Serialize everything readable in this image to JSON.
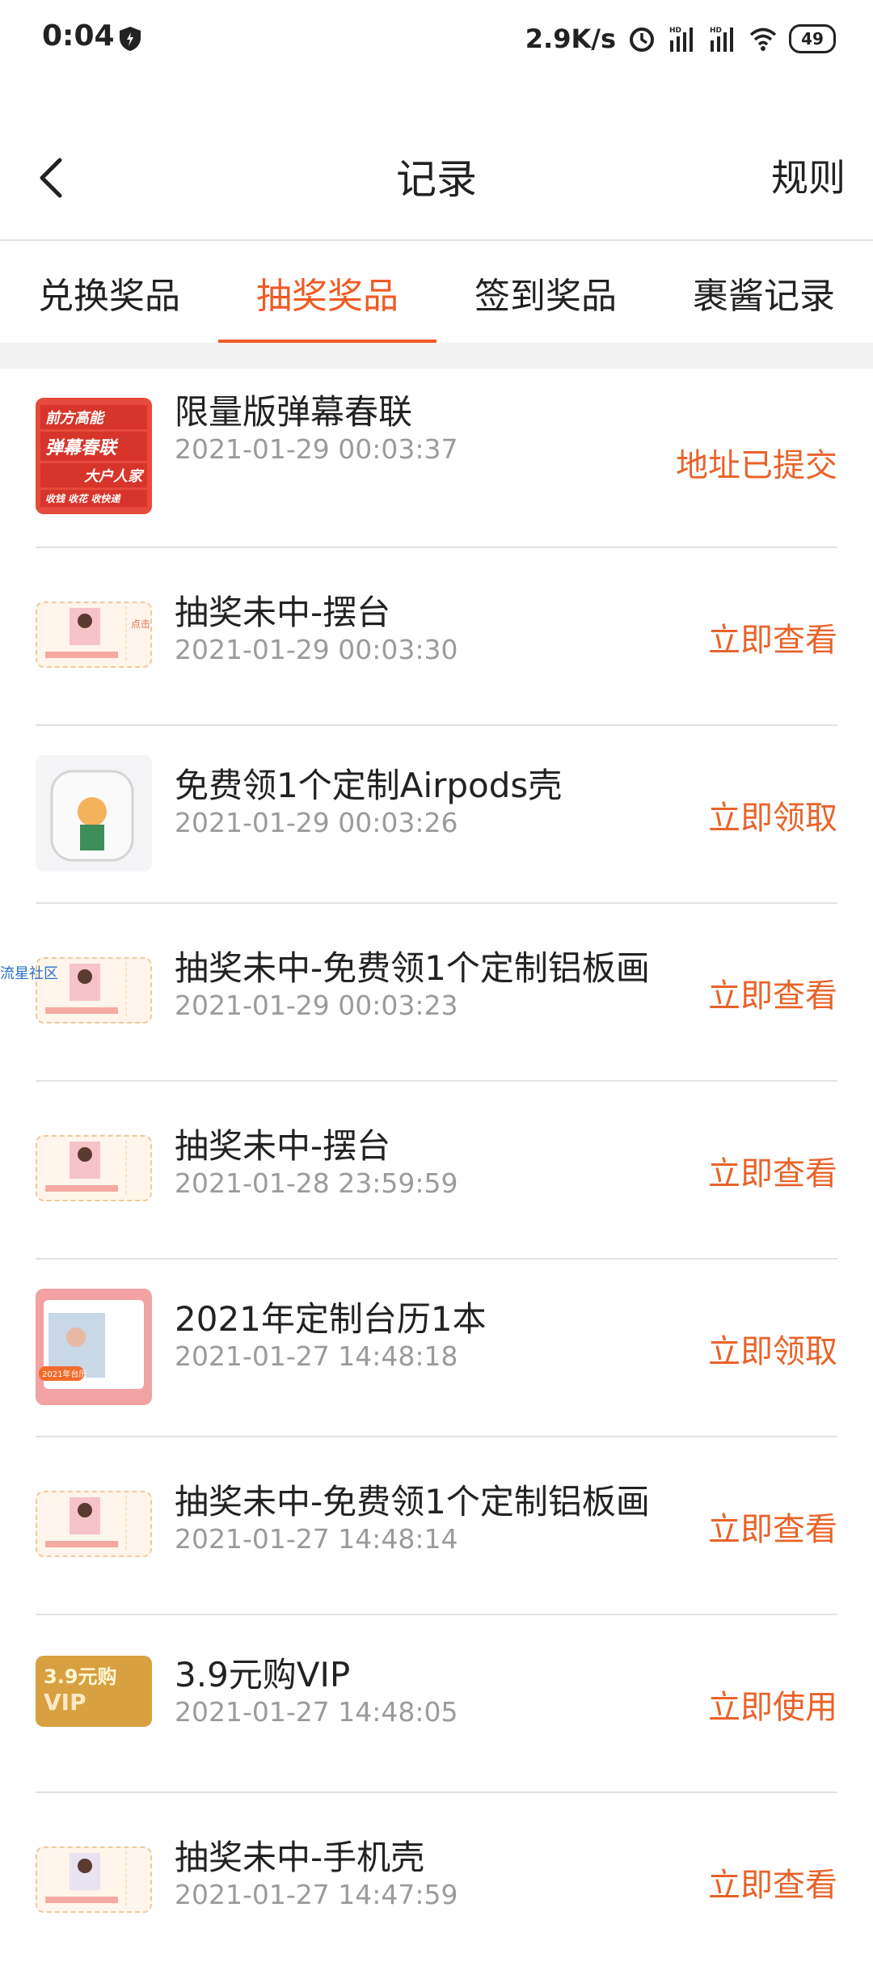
{
  "status": {
    "time": "0:04",
    "speed": "2.9K/s",
    "battery": "49"
  },
  "header": {
    "title": "记录",
    "rules": "规则"
  },
  "tabs": [
    {
      "label": "兑换奖品",
      "active": false
    },
    {
      "label": "抽奖奖品",
      "active": true
    },
    {
      "label": "签到奖品",
      "active": false
    },
    {
      "label": "裹酱记录",
      "active": false
    }
  ],
  "colors": {
    "accent": "#f05a24",
    "action": "#e8632a",
    "date": "#9b9b9b"
  },
  "watermark": "流星社区",
  "rows": [
    {
      "title": "限量版弹幕春联",
      "date": "2021-01-29 00:03:37",
      "action": "地址已提交",
      "thumb": "couplet"
    },
    {
      "title": "抽奖未中-摆台",
      "date": "2021-01-29 00:03:30",
      "action": "立即查看",
      "thumb": "ticket"
    },
    {
      "title": "免费领1个定制Airpods壳",
      "date": "2021-01-29 00:03:26",
      "action": "立即领取",
      "thumb": "case"
    },
    {
      "title": "抽奖未中-免费领1个定制铝板画",
      "date": "2021-01-29 00:03:23",
      "action": "立即查看",
      "thumb": "ticket"
    },
    {
      "title": "抽奖未中-摆台",
      "date": "2021-01-28 23:59:59",
      "action": "立即查看",
      "thumb": "ticket"
    },
    {
      "title": "2021年定制台历1本",
      "date": "2021-01-27 14:48:18",
      "action": "立即领取",
      "thumb": "calendar"
    },
    {
      "title": "抽奖未中-免费领1个定制铝板画",
      "date": "2021-01-27 14:48:14",
      "action": "立即查看",
      "thumb": "ticket"
    },
    {
      "title": "3.9元购VIP",
      "date": "2021-01-27 14:48:05",
      "action": "立即使用",
      "thumb": "vip"
    },
    {
      "title": "抽奖未中-手机壳",
      "date": "2021-01-27 14:47:59",
      "action": "立即查看",
      "thumb": "ticket"
    }
  ],
  "couplet_text": [
    "前方高能",
    "弹幕春联",
    "大户人家",
    "收钱 收花 收快递"
  ],
  "vip_text": [
    "3.9元购",
    "VIP"
  ],
  "calendar_badge": "2021年台历",
  "ticket_side": "点击领取"
}
